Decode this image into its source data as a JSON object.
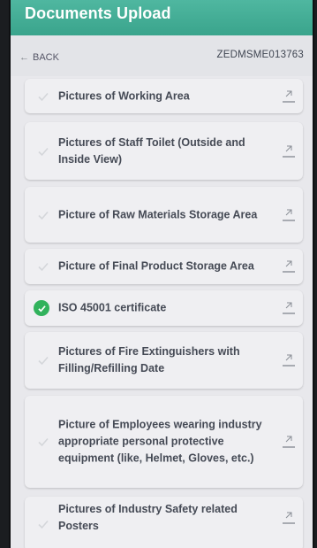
{
  "header": {
    "title": "Documents Upload"
  },
  "subbar": {
    "back_label": "BACK",
    "application_id": "ZEDMSME013763"
  },
  "documents": [
    {
      "label": "Pictures of Working Area",
      "uploaded": false
    },
    {
      "label": "Pictures of Staff Toilet (Outside and Inside View)",
      "uploaded": false
    },
    {
      "label": "Picture of Raw Materials Storage Area",
      "uploaded": false
    },
    {
      "label": "Picture of Final Product Storage Area",
      "uploaded": false
    },
    {
      "label": "ISO 45001 certificate",
      "uploaded": true
    },
    {
      "label": "Pictures of Fire Extinguishers with Filling/Refilling Date",
      "uploaded": false
    },
    {
      "label": "Picture of Employees wearing industry appropriate personal protective equipment (like, Helmet, Gloves, etc.)",
      "uploaded": false
    },
    {
      "label": "Pictures of Industry Safety related Posters",
      "uploaded": false
    }
  ],
  "colors": {
    "header": "#3fae95",
    "check_done": "#31b25c",
    "card": "#efeff2"
  }
}
